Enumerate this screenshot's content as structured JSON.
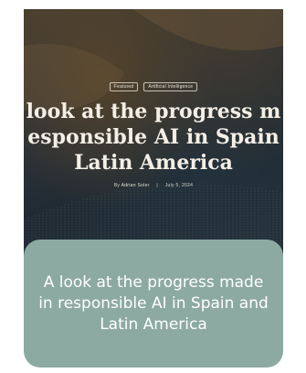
{
  "hero": {
    "tags": [
      "Featured",
      "Artificial Intelligence"
    ],
    "title_lines": [
      "look at the progress m",
      "esponsible AI in Spain",
      "Latin America"
    ],
    "byline": {
      "prefix": "By",
      "author": "Adrian Soler",
      "date": "July 5, 2024"
    }
  },
  "caption": {
    "text": "A look at the progress made in responsible AI in Spain and Latin America"
  },
  "colors": {
    "caption_bg": "#8caaa2",
    "caption_text": "#ffffff",
    "hero_title": "#f4efe6"
  }
}
